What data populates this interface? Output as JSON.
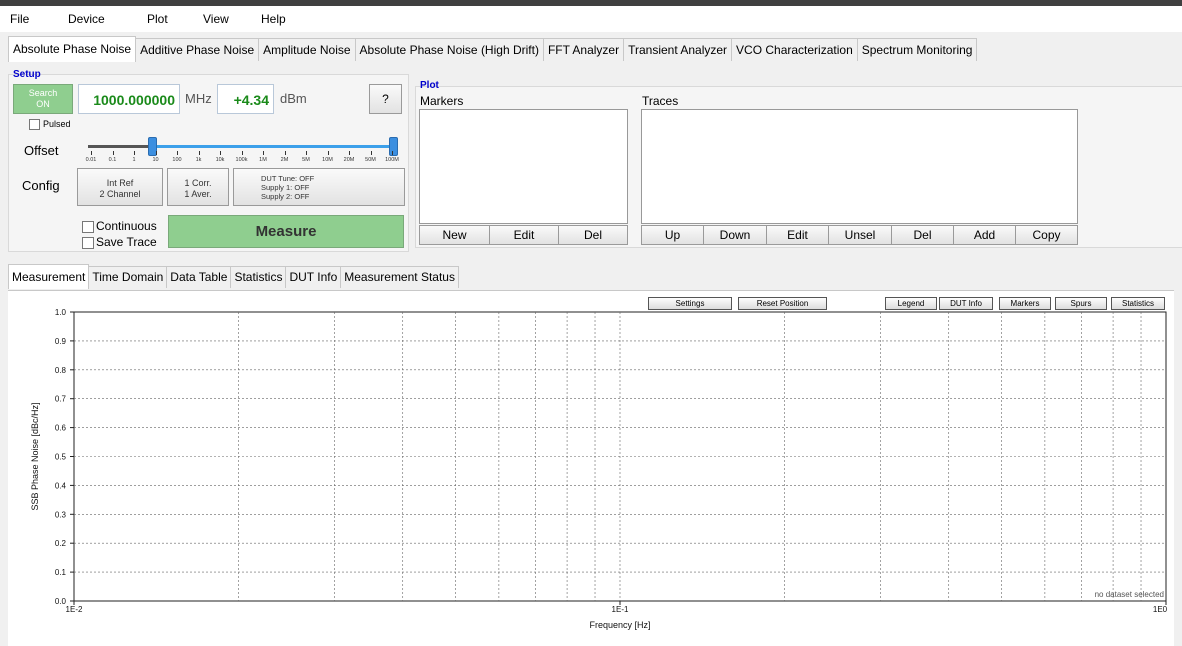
{
  "menu": [
    "File",
    "Device",
    "Plot",
    "View",
    "Help"
  ],
  "tabs": [
    "Absolute Phase Noise",
    "Additive Phase Noise",
    "Amplitude Noise",
    "Absolute Phase Noise (High Drift)",
    "FFT Analyzer",
    "Transient Analyzer",
    "VCO Characterization",
    "Spectrum Monitoring"
  ],
  "setup": {
    "title": "Setup",
    "search_line1": "Search",
    "search_line2": "ON",
    "frequency": "1000.000000",
    "frequency_unit": "MHz",
    "power": "+4.34",
    "power_unit": "dBm",
    "help": "?",
    "pulsed": "Pulsed",
    "offset_label": "Offset",
    "offset_ticks": [
      "0.01",
      "0.1",
      "1",
      "10",
      "100",
      "1k",
      "10k",
      "100k",
      "1M",
      "2M",
      "5M",
      "10M",
      "20M",
      "50M",
      "100M"
    ],
    "config_label": "Config",
    "ref_line1": "Int Ref",
    "ref_line2": "2 Channel",
    "corr_line1": "1 Corr.",
    "corr_line2": "1 Aver.",
    "dut_line1": "DUT Tune: OFF",
    "dut_line2": "Supply 1: OFF",
    "dut_line3": "Supply 2: OFF",
    "continuous": "Continuous",
    "save_trace": "Save Trace",
    "measure": "Measure"
  },
  "plot_group": {
    "title": "Plot",
    "markers_label": "Markers",
    "traces_label": "Traces",
    "marker_buttons": [
      "New",
      "Edit",
      "Del"
    ],
    "trace_buttons": [
      "Up",
      "Down",
      "Edit",
      "Unsel",
      "Del",
      "Add",
      "Copy"
    ]
  },
  "subtabs": [
    "Measurement",
    "Time Domain",
    "Data Table",
    "Statistics",
    "DUT Info",
    "Measurement Status"
  ],
  "plot_buttons": {
    "settings": "Settings",
    "reset_position": "Reset Position",
    "legend": "Legend",
    "dut_info": "DUT Info",
    "markers": "Markers",
    "spurs": "Spurs",
    "statistics": "Statistics"
  },
  "chart_data": {
    "type": "line",
    "xlabel": "Frequency [Hz]",
    "ylabel": "SSB Phase Noise [dBc/Hz]",
    "x_scale": "log",
    "xlim": [
      0.01,
      1
    ],
    "ylim": [
      0.0,
      1.0
    ],
    "x_ticks": [
      "1E-2",
      "1E-1",
      "1E0"
    ],
    "y_ticks": [
      "0.0",
      "0.1",
      "0.2",
      "0.3",
      "0.4",
      "0.5",
      "0.6",
      "0.7",
      "0.8",
      "0.9",
      "1.0"
    ],
    "grid": true,
    "series": [],
    "status_note": "no dataset selected"
  },
  "colors": {
    "accent_green": "#8fce8f",
    "value_green": "#1a8a1a",
    "slider_blue": "#3ca0ea",
    "group_title": "#0000cc"
  }
}
